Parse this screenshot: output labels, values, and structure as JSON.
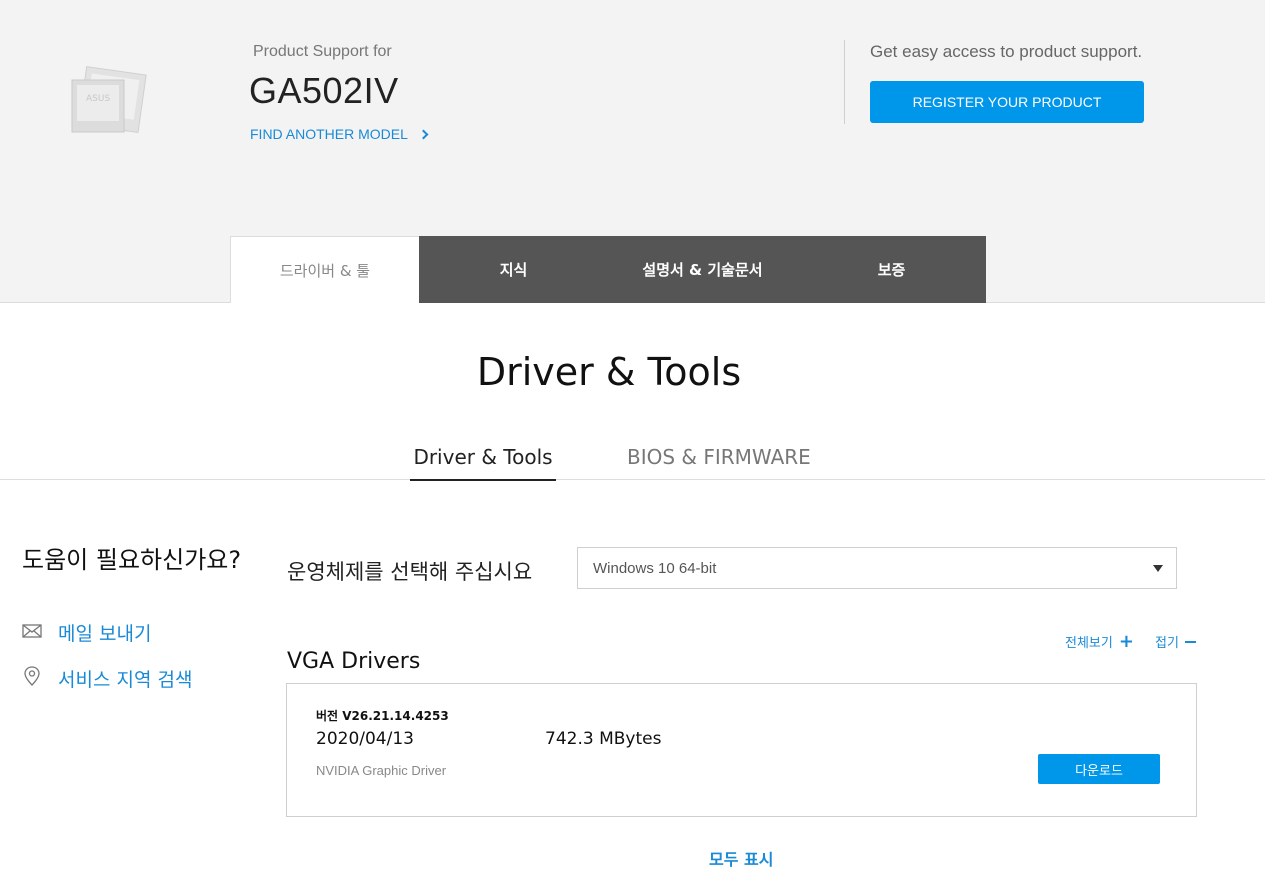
{
  "header": {
    "support_for": "Product Support for",
    "model": "GA502IV",
    "find_another_model": "FIND ANOTHER MODEL",
    "easy_access": "Get easy access to product support.",
    "register_button": "REGISTER YOUR PRODUCT",
    "product_image_text": "ASUS"
  },
  "main_tabs": [
    {
      "label": "드라이버 & 툴",
      "active": true
    },
    {
      "label": "지식",
      "active": false
    },
    {
      "label": "설명서 & 기술문서",
      "active": false
    },
    {
      "label": "보증",
      "active": false
    }
  ],
  "section_title": "Driver & Tools",
  "sub_tabs": [
    {
      "label": "Driver & Tools",
      "active": true
    },
    {
      "label": "BIOS & FIRMWARE",
      "active": false
    }
  ],
  "help": {
    "title": "도움이 필요하신가요?",
    "email_label": "메일 보내기",
    "service_area_label": "서비스 지역 검색"
  },
  "os": {
    "label": "운영체제를 선택해 주십시요",
    "selected": "Windows 10 64-bit"
  },
  "controls": {
    "expand_all": "전체보기",
    "collapse_all": "접기"
  },
  "category": {
    "title": "VGA Drivers",
    "driver": {
      "version": "버전 V26.21.14.4253",
      "date": "2020/04/13",
      "size": "742.3 MBytes",
      "name": "NVIDIA Graphic Driver",
      "download_label": "다운로드"
    }
  },
  "show_all": "모두 표시",
  "colors": {
    "accent": "#0096ea",
    "link": "#1a8ad6",
    "tab_bar": "#555555",
    "header_bg": "#f3f3f3"
  }
}
